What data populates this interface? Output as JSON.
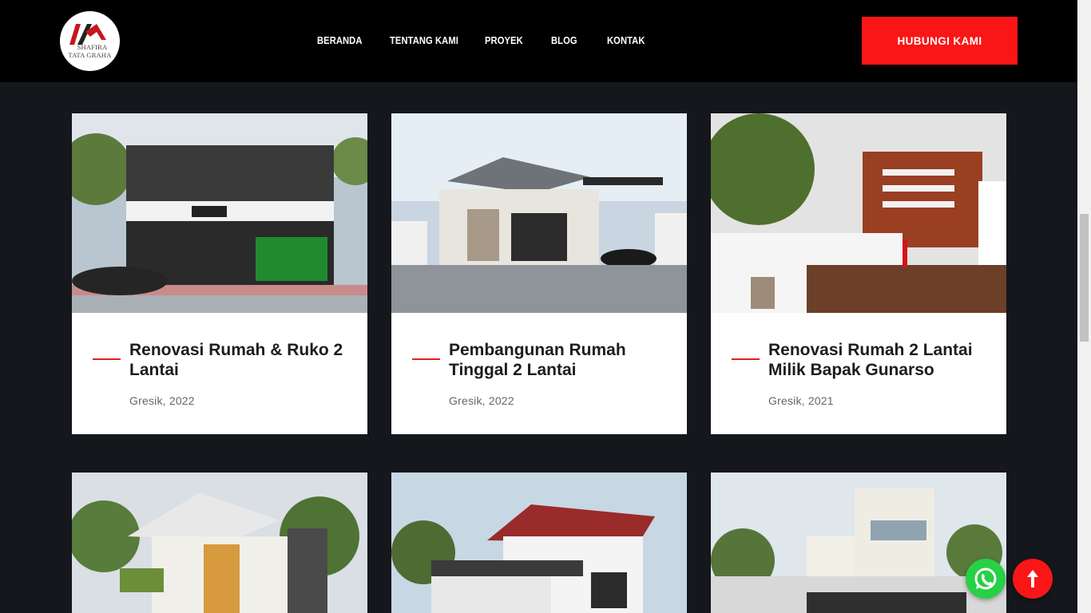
{
  "brand": {
    "logo_line1": "SHAFIRA",
    "logo_line2": "TATA GRAHA",
    "accent": "#fa1616"
  },
  "nav": {
    "items": [
      "BERANDA",
      "TENTANG KAMI",
      "PROYEK",
      "BLOG",
      "KONTAK"
    ],
    "cta_label": "HUBUNGI KAMI"
  },
  "projects": [
    {
      "title": "Renovasi Rumah & Ruko 2 Lantai",
      "meta": "Gresik, 2022"
    },
    {
      "title": "Pembangunan Rumah Tinggal 2 Lantai",
      "meta": "Gresik, 2022"
    },
    {
      "title": "Renovasi Rumah 2 Lantai Milik Bapak Gunarso",
      "meta": "Gresik, 2021"
    }
  ],
  "floating": {
    "whatsapp_icon": "whatsapp-icon",
    "scroll_top_icon": "arrow-up-icon"
  }
}
